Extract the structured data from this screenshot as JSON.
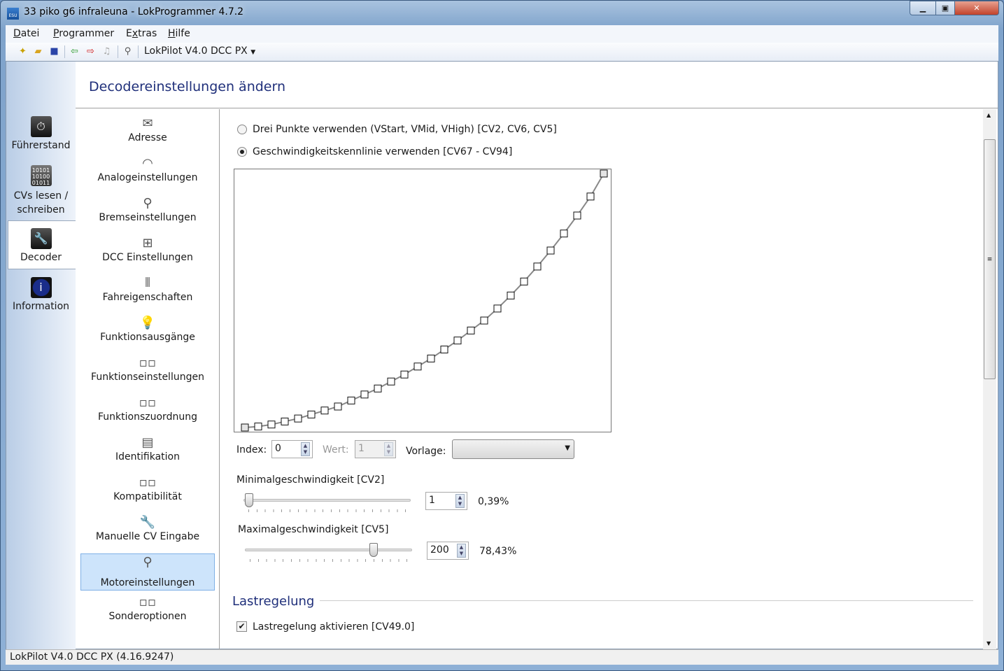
{
  "window": {
    "title": "33 piko g6 infraleuna - LokProgrammer 4.7.2",
    "app_icon": "ESU"
  },
  "menu": [
    {
      "label": "Datei",
      "u": "D",
      "rest": "atei"
    },
    {
      "label": "Programmer",
      "u": "P",
      "rest": "rogrammer"
    },
    {
      "label": "Extras",
      "u": "E",
      "pre": "",
      "rest2": "tras",
      "mid": "x"
    },
    {
      "label": "Hilfe",
      "u": "H",
      "rest": "ilfe"
    }
  ],
  "toolbar": {
    "device": "LokPilot V4.0 DCC PX"
  },
  "nav": [
    {
      "label": "Führerstand",
      "icon": "cab-icon"
    },
    {
      "label": "CVs lesen / schreiben",
      "icon": "binary-icon"
    },
    {
      "label": "Decoder",
      "icon": "wrench-icon",
      "selected": true
    },
    {
      "label": "Information",
      "icon": "info-icon"
    }
  ],
  "header": {
    "title": "Decodereinstellungen ändern"
  },
  "categories": [
    {
      "label": "Adresse",
      "glyph": "✉"
    },
    {
      "label": "Analogeinstellungen",
      "glyph": "◠"
    },
    {
      "label": "Bremseinstellungen",
      "glyph": "⚲"
    },
    {
      "label": "DCC Einstellungen",
      "glyph": "⊞"
    },
    {
      "label": "Fahreigenschaften",
      "glyph": "⫴"
    },
    {
      "label": "Funktionsausgänge",
      "glyph": "💡"
    },
    {
      "label": "Funktionseinstellungen",
      "glyph": "▫▫"
    },
    {
      "label": "Funktionszuordnung",
      "glyph": "▫▫"
    },
    {
      "label": "Identifikation",
      "glyph": "▤"
    },
    {
      "label": "Kompatibilität",
      "glyph": "▫▫"
    },
    {
      "label": "Manuelle CV Eingabe",
      "glyph": "🔧"
    },
    {
      "label": "Motoreinstellungen",
      "glyph": "⚲",
      "selected": true
    },
    {
      "label": "Sonderoptionen",
      "glyph": "▫▫"
    }
  ],
  "settings": {
    "radio1": {
      "label": "Drei Punkte verwenden (VStart, VMid, VHigh) [CV2, CV6, CV5]",
      "checked": false
    },
    "radio2": {
      "label": "Geschwindigkeitskennlinie verwenden [CV67 - CV94]",
      "checked": true
    },
    "index_label": "Index:",
    "index_value": "0",
    "wert_label": "Wert:",
    "wert_value": "1",
    "vorlage_label": "Vorlage:",
    "vorlage_value": "",
    "min_label": "Minimalgeschwindigkeit [CV2]",
    "min_value": "1",
    "min_percent": "0,39%",
    "min_slider": 1,
    "max_label": "Maximalgeschwindigkeit [CV5]",
    "max_value": "200",
    "max_percent": "78,43%",
    "max_slider": 200,
    "slider_range": [
      0,
      255
    ],
    "section": "Lastregelung",
    "load_check": {
      "label": "Lastregelung aktivieren [CV49.0]",
      "checked": true
    }
  },
  "chart_data": {
    "type": "line",
    "x": [
      0,
      1,
      2,
      3,
      4,
      5,
      6,
      7,
      8,
      9,
      10,
      11,
      12,
      13,
      14,
      15,
      16,
      17,
      18,
      19,
      20,
      21,
      22,
      23,
      24,
      25,
      26,
      27
    ],
    "values": [
      1,
      2,
      4,
      7,
      10,
      14,
      18,
      22,
      28,
      34,
      40,
      47,
      54,
      62,
      70,
      79,
      88,
      98,
      108,
      120,
      133,
      147,
      162,
      178,
      195,
      213,
      232,
      255
    ],
    "xlim": [
      0,
      27
    ],
    "ylim": [
      0,
      255
    ],
    "marker": "square",
    "line_color": "#888888"
  },
  "status": {
    "text": "LokPilot V4.0 DCC PX (4.16.9247)"
  }
}
